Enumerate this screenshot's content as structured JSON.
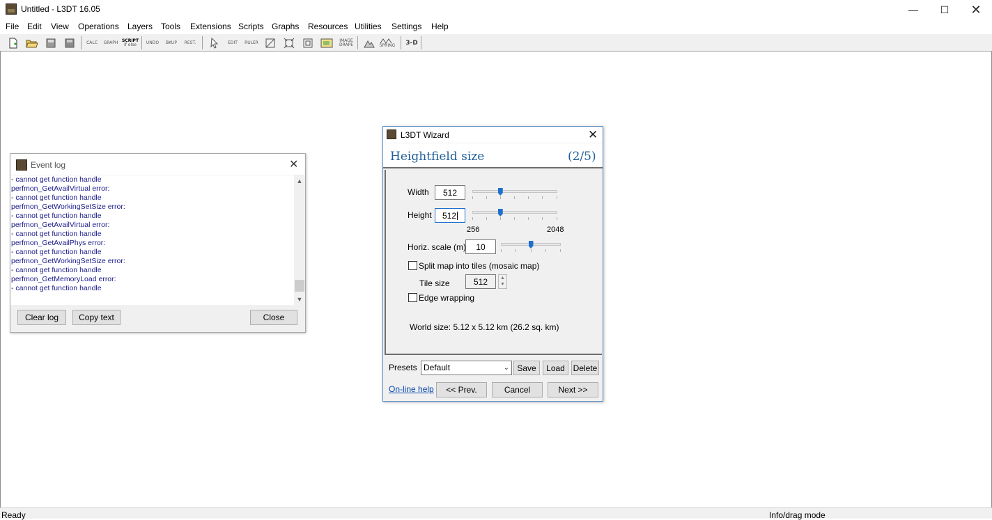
{
  "window": {
    "title": "Untitled - L3DT 16.05",
    "minimize_glyph": "—",
    "maximize_glyph": "☐",
    "close_glyph": "✕"
  },
  "menu": [
    "File",
    "Edit",
    "View",
    "Operations",
    "Layers",
    "Tools",
    "Extensions",
    "Scripts",
    "Graphs",
    "Resources",
    "Utilities",
    "Settings",
    "Help"
  ],
  "toolbar": {
    "calc": "CALC",
    "graph": "GRAPH",
    "script": "SCRIPT",
    "script_sub": "if else",
    "undo": "UNDO",
    "bkup": "BKUP",
    "rest": "REST.",
    "edit": "EDIT",
    "ruler": "RULER",
    "image": "IMAGE",
    "drape": "DRAPE",
    "spring": "SPRING",
    "three_d": "3-D"
  },
  "status": {
    "left": "Ready",
    "right": "Info/drag mode"
  },
  "event_log": {
    "title": "Event log",
    "lines": [
      " - cannot get function handle",
      "perfmon_GetAvailVirtual error:",
      " - cannot get function handle",
      "perfmon_GetWorkingSetSize error:",
      " - cannot get function handle",
      "perfmon_GetAvailVirtual error:",
      " - cannot get function handle",
      "perfmon_GetAvailPhys error:",
      " - cannot get function handle",
      "perfmon_GetWorkingSetSize error:",
      " - cannot get function handle",
      "perfmon_GetMemoryLoad error:",
      " - cannot get function handle"
    ],
    "clear_label": "Clear log",
    "copy_label": "Copy text",
    "close_label": "Close"
  },
  "wizard": {
    "title": "L3DT Wizard",
    "heading": "Heightfield size",
    "step": "(2/5)",
    "width_label": "Width",
    "width_value": "512",
    "height_label": "Height",
    "height_value": "512",
    "size_min_label": "256",
    "size_max_label": "2048",
    "width_slider_fraction": 0.33,
    "height_slider_fraction": 0.33,
    "hscale_label": "Horiz. scale (m)",
    "hscale_value": "10",
    "hscale_slider_fraction": 0.5,
    "split_label": "Split map into tiles (mosaic map)",
    "split_checked": false,
    "tile_size_label": "Tile size",
    "tile_size_value": "512",
    "edge_wrap_label": "Edge wrapping",
    "edge_wrap_checked": false,
    "world_size_text": "World size: 5.12 x 5.12 km (26.2 sq. km)",
    "presets_label": "Presets",
    "presets_value": "Default",
    "save_label": "Save",
    "load_label": "Load",
    "delete_label": "Delete",
    "help_link": "On-line help",
    "prev_label": "<< Prev.",
    "cancel_label": "Cancel",
    "next_label": "Next >>"
  }
}
